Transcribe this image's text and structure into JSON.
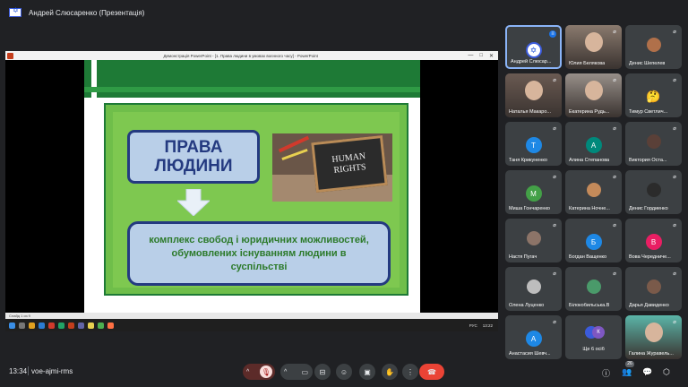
{
  "header": {
    "presenter_name": "Андрей Слюсаренко (Презентація)"
  },
  "slide_window": {
    "title": "Демонстрація PowerPoint - [1. Права людини в умовах воєнного часу] - PowerPoint",
    "controls": [
      "—",
      "□",
      "✕"
    ],
    "rights_title": "ПРАВА\nЛЮДИНИ",
    "image_text": "HUMAN\nRIGHTS",
    "definition": "комплекс свобод і юридичних можливостей, обумовлених існуванням людини в суспільстві",
    "status_text": "Слайд 1 из 9",
    "taskbar_lang": "РУС",
    "taskbar_time": "13:22"
  },
  "participants": [
    {
      "name": "Андрей Слюсар...",
      "type": "flag",
      "active": true
    },
    {
      "name": "Юлия Белякова",
      "type": "video",
      "color": "#8a7a6e"
    },
    {
      "name": "Денис Шепелев",
      "type": "face",
      "color": "#b0704a"
    },
    {
      "name": "Наталья Макаро...",
      "type": "video",
      "color": "#6a5a52"
    },
    {
      "name": "Екатерина Рудь...",
      "type": "video",
      "color": "#98908a"
    },
    {
      "name": "Тимур Светлич...",
      "type": "emoji",
      "icon": "🤔"
    },
    {
      "name": "Таня Крикуненко",
      "type": "initial",
      "initial": "Т",
      "color": "#1e88e5"
    },
    {
      "name": "Алина Степанова",
      "type": "initial",
      "initial": "А",
      "color": "#00897b"
    },
    {
      "name": "Виктория Оста...",
      "type": "face",
      "color": "#5a4038"
    },
    {
      "name": "Миша Гончаренко",
      "type": "initial",
      "initial": "М",
      "color": "#43a047"
    },
    {
      "name": "Катерина Ночне...",
      "type": "face",
      "color": "#c48a5a"
    },
    {
      "name": "Денис Гордиенко",
      "type": "face",
      "color": "#2b2b2b"
    },
    {
      "name": "Настя Пугач",
      "type": "face",
      "color": "#8c7468"
    },
    {
      "name": "Богдан Ващенко",
      "type": "initial",
      "initial": "Б",
      "color": "#1e88e5"
    },
    {
      "name": "Вова Чередниче...",
      "type": "initial",
      "initial": "В",
      "color": "#e91e63"
    },
    {
      "name": "Олена Луценко",
      "type": "face",
      "color": "#bdbdbd"
    },
    {
      "name": "Білокобильська.В",
      "type": "face",
      "color": "#4a9a6a"
    },
    {
      "name": "Дарья Давиденко",
      "type": "face",
      "color": "#7a5a4a"
    },
    {
      "name": "Анастасия Шевч...",
      "type": "initial",
      "initial": "А",
      "color": "#1e88e5"
    },
    {
      "name": "Ще 6 осіб",
      "type": "more",
      "initial": "К",
      "color": "#7e57c2"
    },
    {
      "name": "Галина Журавель...",
      "type": "video",
      "color": "#5bb5a8"
    }
  ],
  "bottom": {
    "time": "13:34",
    "meeting_code": "voe-ajmi-rms",
    "participant_count": "26"
  },
  "colors": {
    "background": "#202124",
    "tile": "#3c4043",
    "hangup": "#ea4335",
    "accent": "#8ab4f8",
    "slide_green": "#1e7a36",
    "slide_navy": "#243a80"
  }
}
